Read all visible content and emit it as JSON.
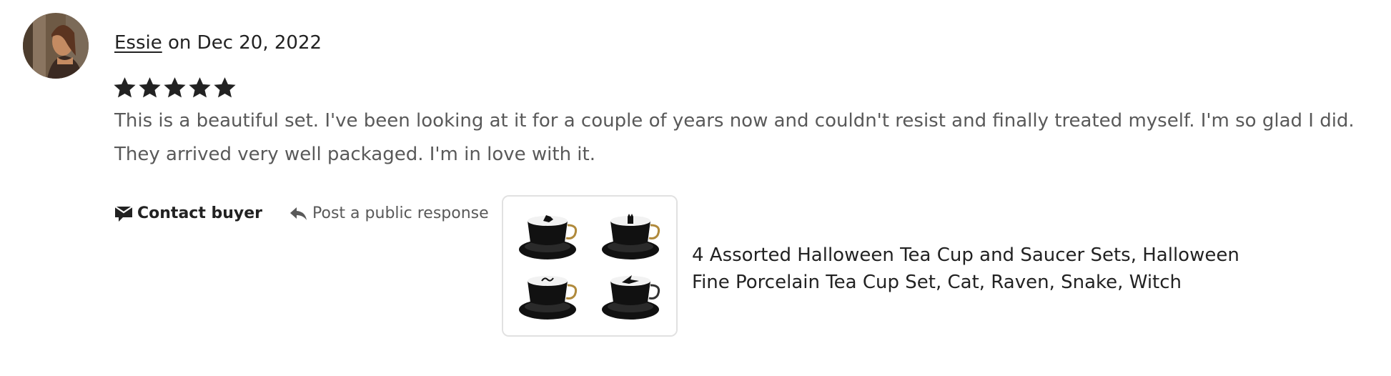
{
  "review": {
    "author": "Essie",
    "date_prefix": " on ",
    "date": "Dec 20, 2022",
    "rating": 5,
    "rating_max": 5,
    "text": "This is a beautiful set. I've been looking at it for a couple of years now and couldn't resist and finally treated myself. I'm so glad I did. They arrived very well packaged. I'm in love with it."
  },
  "actions": {
    "contact_label": "Contact buyer",
    "respond_label": "Post a public response"
  },
  "product": {
    "title": "4 Assorted Halloween Tea Cup and Saucer Sets, Halloween Fine Porcelain Tea Cup Set, Cat, Raven, Snake, Witch"
  },
  "icons": {
    "contact": "envelope-chat-icon",
    "respond": "reply-arrow-icon",
    "star": "star-filled-icon"
  },
  "colors": {
    "text_primary": "#222222",
    "text_secondary": "#595959",
    "star": "#222222",
    "border": "#e1e1e1"
  }
}
